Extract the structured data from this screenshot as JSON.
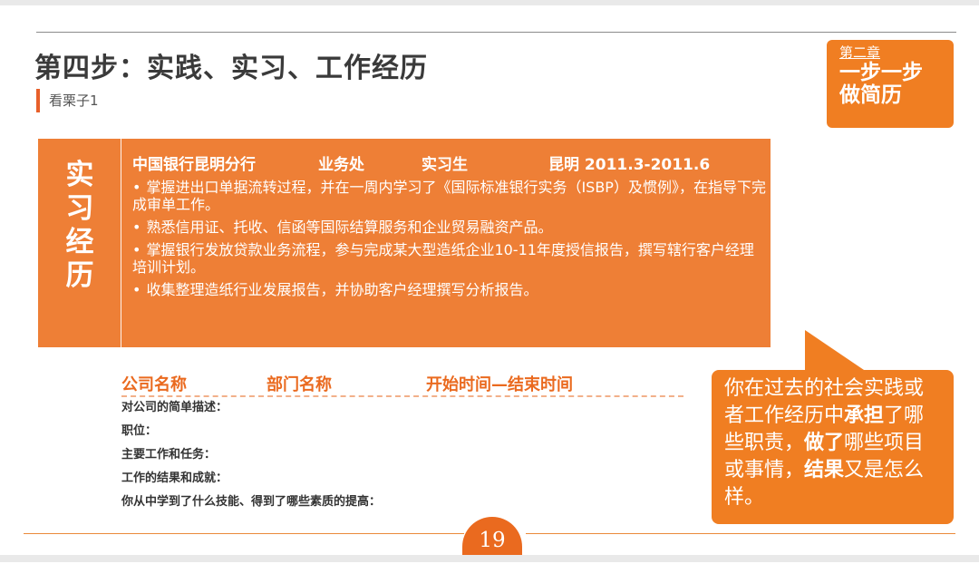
{
  "slide": {
    "title": "第四步：实践、实习、工作经历",
    "subtitle": "看栗子1",
    "page_number": "19",
    "accent_color": "#ee7f36"
  },
  "chapter": {
    "label": "第二章",
    "line1": "一步一步",
    "line2": "做简历"
  },
  "experience": {
    "side_chars": [
      "实",
      "习",
      "经",
      "历"
    ],
    "organization": "中国银行昆明分行",
    "department": "业务处",
    "role": "实习生",
    "location_date": "昆明 2011.3-2011.6",
    "bullets": [
      "掌握进出口单据流转过程，并在一周内学习了《国际标准银行实务（ISBP）及惯例》，在指导下完成审单工作。",
      "熟悉信用证、托收、信函等国际结算服务和企业贸易融资产品。",
      "掌握银行发放贷款业务流程，参与完成某大型造纸企业10-11年度授信报告，撰写辖行客户经理培训计划。",
      "收集整理造纸行业发展报告，并协助客户经理撰写分析报告。"
    ],
    "bullet_marker": "•"
  },
  "template": {
    "company": "公司名称",
    "department": "部门名称",
    "period": "开始时间—结束时间",
    "lines": [
      "对公司的简单描述：",
      "职位：",
      "主要工作和任务：",
      "工作的结果和成就：",
      "你从中学到了什么技能、得到了哪些素质的提高："
    ]
  },
  "callout": {
    "part1": "你在过去的社会实践或者工作经历中",
    "bold1": "承担",
    "part2": "了哪些职责，",
    "bold2": "做了",
    "part3": "哪些项目或事情，",
    "bold3": "结果",
    "part4": "又是怎么样。"
  }
}
